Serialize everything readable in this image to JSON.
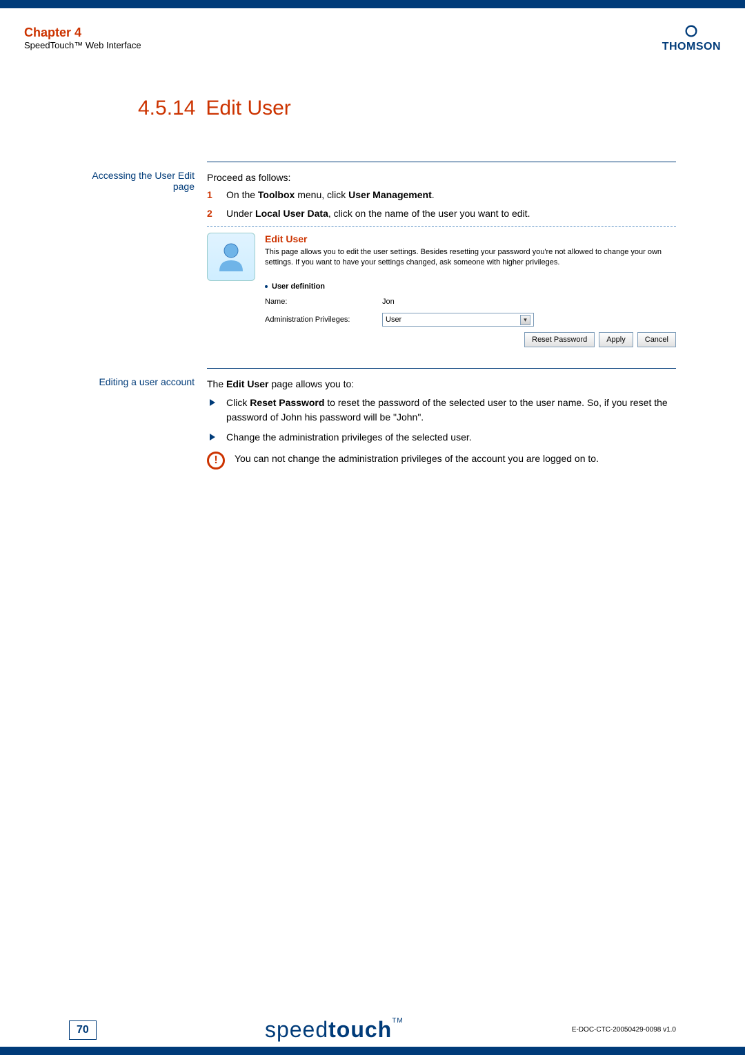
{
  "header": {
    "chapter": "Chapter 4",
    "subtitle": "SpeedTouch™ Web Interface",
    "brand": "THOMSON"
  },
  "section": {
    "number": "4.5.14",
    "title": "Edit User"
  },
  "access": {
    "sidelabel_line1": "Accessing the User Edit",
    "sidelabel_line2": "page",
    "intro": "Proceed as follows:",
    "step1_prefix": "On the ",
    "step1_b1": "Toolbox",
    "step1_mid": " menu, click ",
    "step1_b2": "User Management",
    "step1_suffix": ".",
    "step2_prefix": "Under ",
    "step2_b1": "Local User Data",
    "step2_suffix": ", click on the name of the user you want to edit."
  },
  "embed": {
    "title": "Edit User",
    "desc": "This page allows you to edit the user settings. Besides resetting your password you're not allowed to change your own settings. If you want to have your settings changed, ask someone with higher privileges.",
    "section_title": "User definition",
    "name_label": "Name:",
    "name_value": "Jon",
    "priv_label": "Administration Privileges:",
    "priv_value": "User",
    "btn_reset": "Reset Password",
    "btn_apply": "Apply",
    "btn_cancel": "Cancel"
  },
  "editing": {
    "sidelabel": "Editing a user account",
    "intro_prefix": "The ",
    "intro_b": "Edit User",
    "intro_suffix": " page allows you to:",
    "li1_prefix": "Click ",
    "li1_b": "Reset Password",
    "li1_suffix": " to reset the password of the selected user to the user name. So, if you reset the password of John his password will be \"John\".",
    "li2": "Change the administration privileges of the selected user.",
    "warn": "You can not change the administration privileges of the account you are logged on to."
  },
  "footer": {
    "page": "70",
    "brand_thin": "speed",
    "brand_bold": "touch",
    "tm": "TM",
    "doc": "E-DOC-CTC-20050429-0098 v1.0"
  }
}
